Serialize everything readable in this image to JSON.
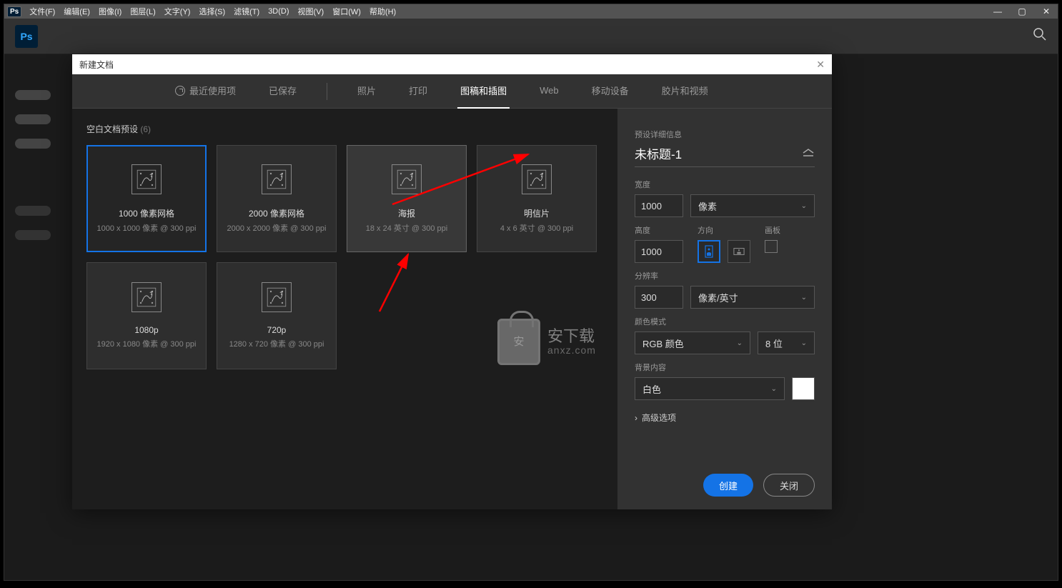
{
  "menubar": {
    "file": "文件(F)",
    "edit": "编辑(E)",
    "image": "图像(I)",
    "layer": "图层(L)",
    "type": "文字(Y)",
    "select": "选择(S)",
    "filter": "滤镜(T)",
    "threeD": "3D(D)",
    "view": "视图(V)",
    "window": "窗口(W)",
    "help": "帮助(H)"
  },
  "app_logo": "Ps",
  "dialog": {
    "title": "新建文档",
    "tabs": {
      "recent": "最近使用项",
      "saved": "已保存",
      "photo": "照片",
      "print": "打印",
      "art": "图稿和插图",
      "web": "Web",
      "mobile": "移动设备",
      "film": "胶片和视频"
    },
    "presets_header": "空白文档预设",
    "presets_count": "(6)",
    "presets": [
      {
        "name": "1000 像素网格",
        "dims": "1000 x 1000 像素 @ 300 ppi"
      },
      {
        "name": "2000 像素网格",
        "dims": "2000 x 2000 像素 @ 300 ppi"
      },
      {
        "name": "海报",
        "dims": "18 x 24 英寸 @ 300 ppi"
      },
      {
        "name": "明信片",
        "dims": "4 x 6 英寸 @ 300 ppi"
      },
      {
        "name": "1080p",
        "dims": "1920 x 1080 像素 @ 300 ppi"
      },
      {
        "name": "720p",
        "dims": "1280 x 720 像素 @ 300 ppi"
      }
    ],
    "details": {
      "header": "预设详细信息",
      "doc_name": "未标题-1",
      "width_label": "宽度",
      "width_value": "1000",
      "width_unit": "像素",
      "height_label": "高度",
      "height_value": "1000",
      "orientation_label": "方向",
      "artboard_label": "画板",
      "resolution_label": "分辨率",
      "resolution_value": "300",
      "resolution_unit": "像素/英寸",
      "color_mode_label": "颜色模式",
      "color_mode_value": "RGB 颜色",
      "bit_depth": "8 位",
      "background_label": "背景内容",
      "background_value": "白色",
      "advanced": "高级选项"
    },
    "buttons": {
      "create": "创建",
      "close": "关闭"
    }
  },
  "watermark": {
    "cn": "安下载",
    "en": "anxz.com"
  }
}
